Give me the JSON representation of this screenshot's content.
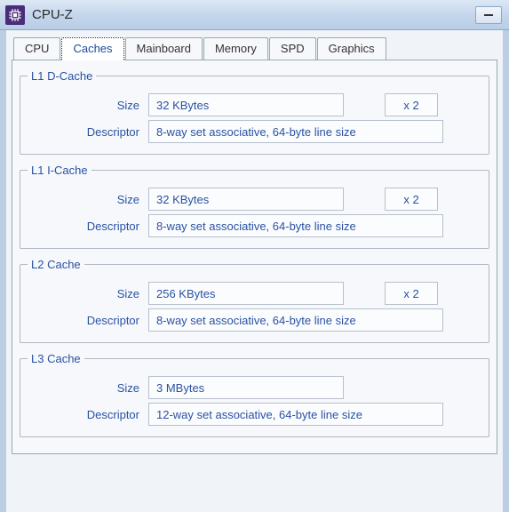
{
  "window": {
    "title": "CPU-Z"
  },
  "tabs": [
    {
      "label": "CPU"
    },
    {
      "label": "Caches"
    },
    {
      "label": "Mainboard"
    },
    {
      "label": "Memory"
    },
    {
      "label": "SPD"
    },
    {
      "label": "Graphics"
    }
  ],
  "active_tab_index": 1,
  "labels": {
    "size": "Size",
    "descriptor": "Descriptor"
  },
  "caches": [
    {
      "title": "L1 D-Cache",
      "size": "32 KBytes",
      "multiplier": "x 2",
      "descriptor": "8-way set associative, 64-byte line size"
    },
    {
      "title": "L1 I-Cache",
      "size": "32 KBytes",
      "multiplier": "x 2",
      "descriptor": "8-way set associative, 64-byte line size"
    },
    {
      "title": "L2 Cache",
      "size": "256 KBytes",
      "multiplier": "x 2",
      "descriptor": "8-way set associative, 64-byte line size"
    },
    {
      "title": "L3 Cache",
      "size": "3 MBytes",
      "multiplier": "",
      "descriptor": "12-way set associative, 64-byte line size"
    }
  ]
}
